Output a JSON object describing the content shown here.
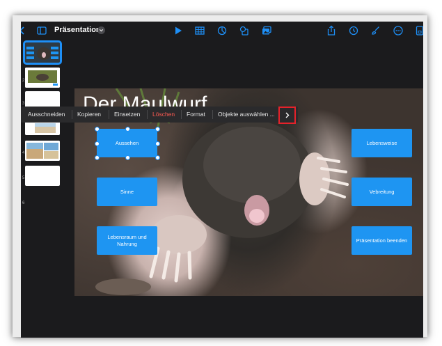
{
  "toolbar": {
    "title": "Präsentation",
    "icons": [
      "back-chevron-icon",
      "sidebar-icon",
      "play-icon",
      "table-icon",
      "chart-icon",
      "shape-icon",
      "media-icon",
      "share-icon",
      "history-icon",
      "brush-icon",
      "more-icon",
      "document-icon"
    ]
  },
  "sidebar": {
    "slide_numbers": [
      "1",
      "2",
      "3",
      "4",
      "5",
      "6"
    ]
  },
  "slide": {
    "title": "Der Maulwurf"
  },
  "context_menu": {
    "items": [
      "Ausschneiden",
      "Kopieren",
      "Einsetzen",
      "Löschen",
      "Format",
      "Objekte auswählen ..."
    ],
    "more_icon": "chevron-right-icon"
  },
  "buttons": {
    "aussehen": "Aussehen",
    "sinne": "Sinne",
    "lebensraum": "Lebensraum und Nahrung",
    "lebensweise": "Lebensweise",
    "verbreitung": "Vebreitung",
    "beenden": "Präsentation beenden"
  },
  "colors": {
    "accent": "#1e95f2",
    "danger": "#ff5b52",
    "highlight": "#e5222a"
  }
}
